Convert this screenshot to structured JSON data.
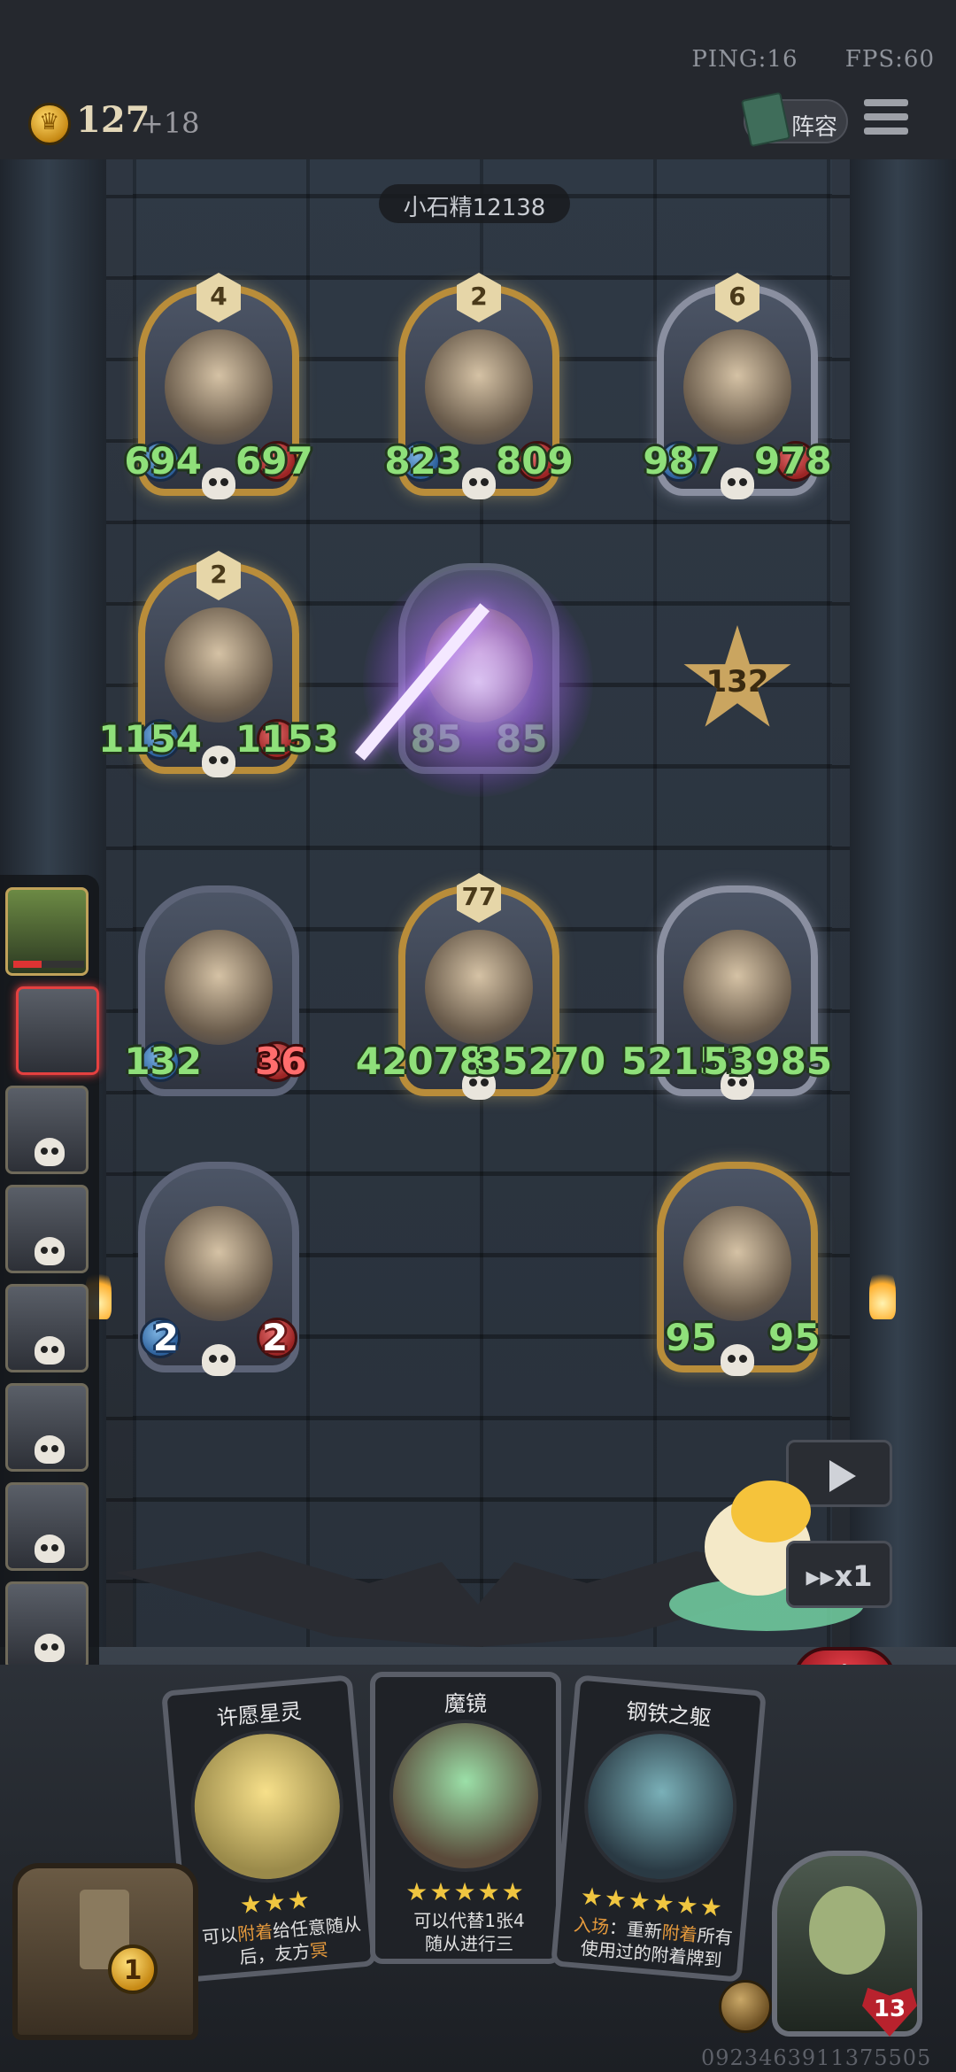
{
  "status": {
    "ping": "PING:16",
    "fps": "FPS:60"
  },
  "gold": {
    "amount": "127",
    "income": "+18"
  },
  "lineup": {
    "label": "阵容"
  },
  "opponent_name": "小石精12138",
  "damage": "132",
  "board": [
    {
      "name": "wizard",
      "tier": "4",
      "atk": "694",
      "hp": "697",
      "style": "gold"
    },
    {
      "name": "cyborg-scientist",
      "tier": "2",
      "atk": "823",
      "hp": "809",
      "style": "gold"
    },
    {
      "name": "armored-knight",
      "tier": "6",
      "atk": "987",
      "hp": "978",
      "style": "silver"
    },
    {
      "name": "old-mechanic",
      "tier": "2",
      "atk": "1154",
      "hp": "1153",
      "style": "gold"
    },
    {
      "name": "lightning-target",
      "tier": "",
      "atk": "85",
      "hp": "85",
      "style": "dark"
    },
    {
      "name": "hooded-assassin",
      "tier": "",
      "atk": "132",
      "hp": "36",
      "style": "dark"
    },
    {
      "name": "iron-golem",
      "tier": "77",
      "atk": "42078",
      "hp": "35270",
      "style": "gold"
    },
    {
      "name": "wishing-star",
      "tier": "",
      "atk": "52151",
      "hp": "53985",
      "style": "silver"
    },
    {
      "name": "bell-robot",
      "tier": "",
      "atk": "2",
      "hp": "2",
      "style": "dark"
    },
    {
      "name": "steam-airship",
      "tier": "",
      "atk": "95",
      "hp": "95",
      "style": "gold"
    }
  ],
  "controls": {
    "speed": "x1"
  },
  "shop_cards": [
    {
      "title": "许愿星灵",
      "stars": "★★★",
      "text_pre": "可以",
      "text_key": "附着",
      "text_post": "给任意随从后，友方",
      "text_key2": "冥",
      "text_post2": ""
    },
    {
      "title": "魔镜",
      "stars": "★★★★★",
      "text_pre": "可以代替1张4",
      "text_key": "",
      "text_post": "随从进行三",
      "text_key2": "",
      "text_post2": ""
    },
    {
      "title": "钢铁之躯",
      "stars": "★★★★★★",
      "text_pre": "",
      "text_key": "入场",
      "text_post": "：重新",
      "text_key2": "附着",
      "text_post2": "所有使用过的附着牌到"
    }
  ],
  "tavern_tier": "1",
  "hero": {
    "health": "13"
  },
  "build_id": "0923463911375505",
  "colors": {
    "stat_green": "#8fe07a",
    "gold_frame": "#b98d3a",
    "alert_red": "#e54040"
  }
}
